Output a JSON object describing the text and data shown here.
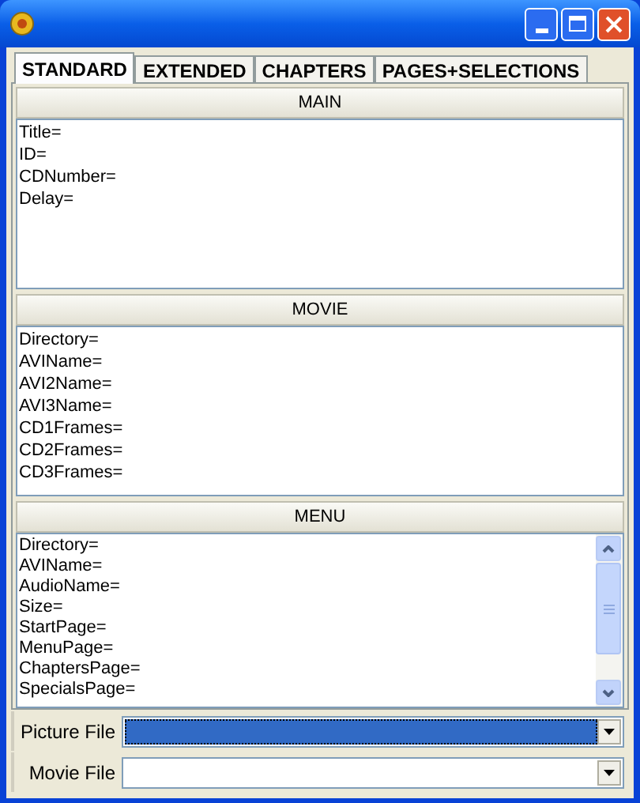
{
  "tabs": [
    {
      "label": "STANDARD",
      "selected": true
    },
    {
      "label": "EXTENDED",
      "selected": false
    },
    {
      "label": "CHAPTERS",
      "selected": false
    },
    {
      "label": "PAGES+SELECTIONS",
      "selected": false
    }
  ],
  "sections": [
    {
      "title": "MAIN",
      "scrollable": false,
      "lines": [
        "Title=",
        "ID=",
        "CDNumber=",
        "Delay="
      ]
    },
    {
      "title": "MOVIE",
      "scrollable": false,
      "lines": [
        "Directory=",
        "AVIName=",
        "AVI2Name=",
        "AVI3Name=",
        "CD1Frames=",
        "CD2Frames=",
        "CD3Frames="
      ]
    },
    {
      "title": "MENU",
      "scrollable": true,
      "lines": [
        "Directory=",
        "AVIName=",
        "AudioName=",
        "Size=",
        "StartPage=",
        "MenuPage=",
        "ChaptersPage=",
        "SpecialsPage="
      ]
    }
  ],
  "fields": [
    {
      "label": "Picture File",
      "highlighted": true
    },
    {
      "label": "Movie File",
      "highlighted": false
    }
  ]
}
